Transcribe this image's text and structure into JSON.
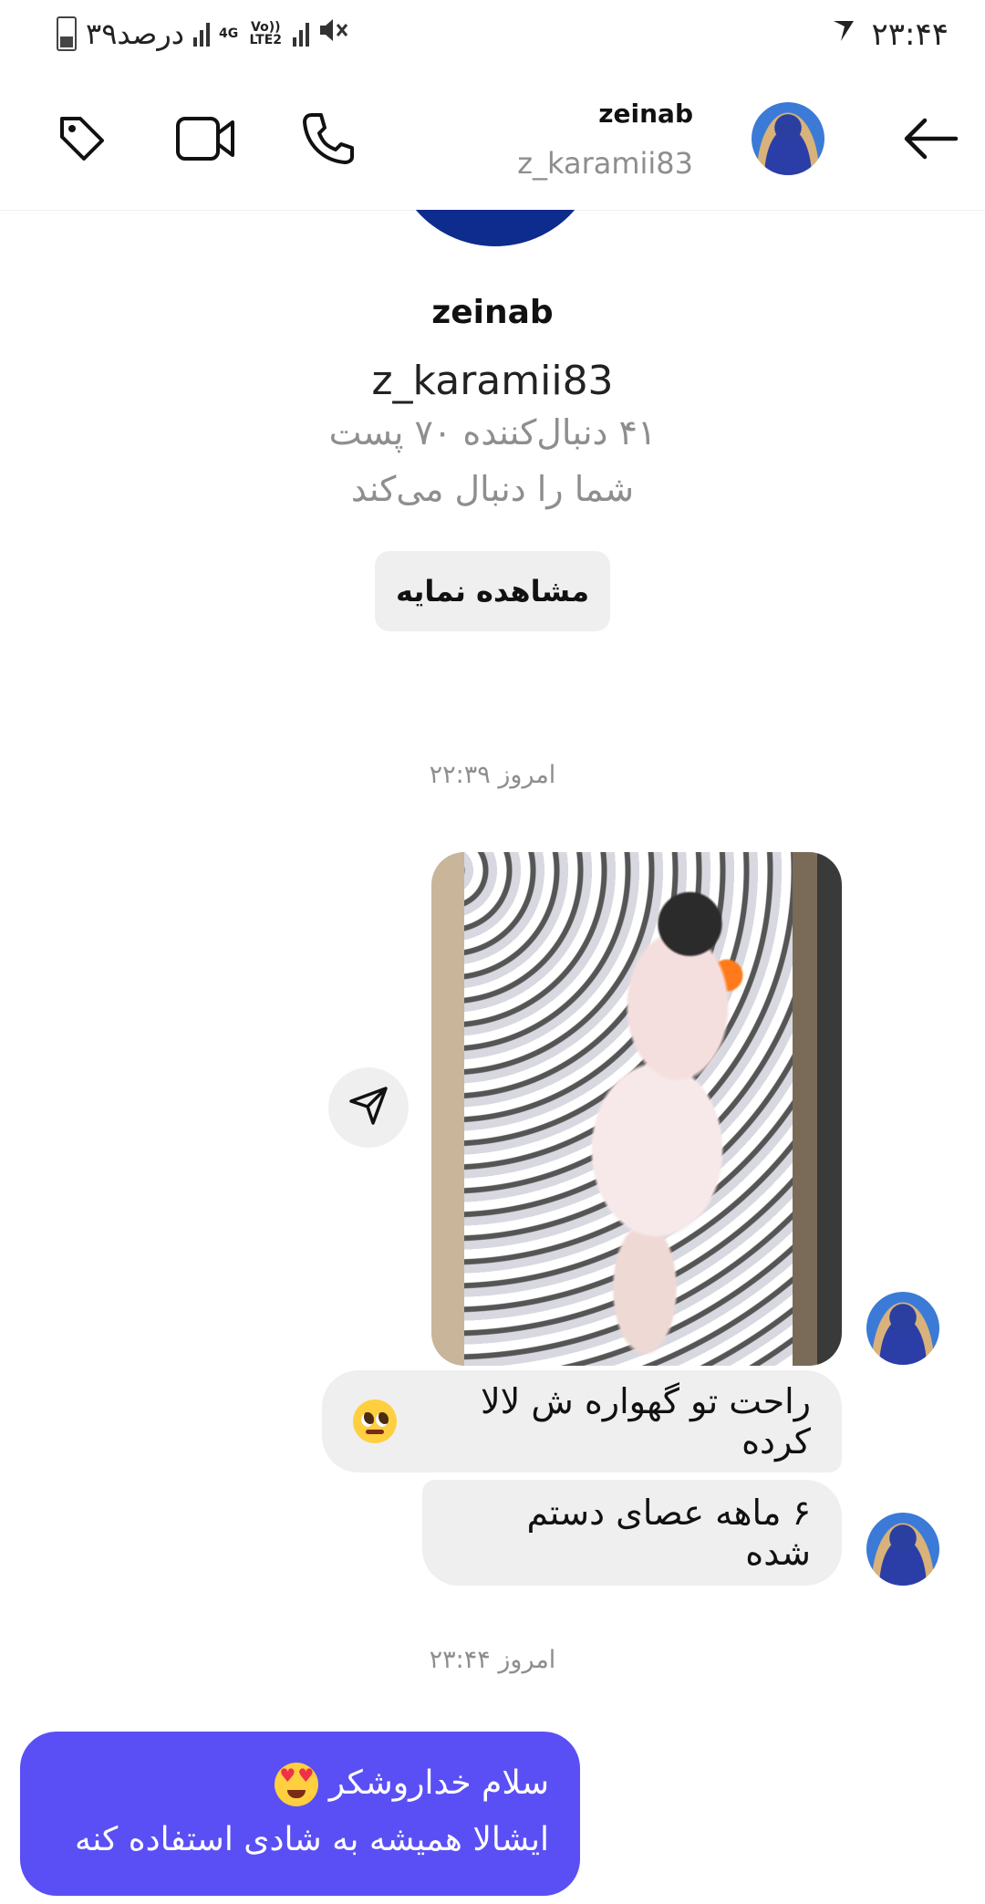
{
  "status_bar": {
    "time": "۲۳:۴۴",
    "battery_text": "۳۹درصد",
    "network_4g": "4G",
    "network_volte": "Vo)) LTE2",
    "carrier_icon": "check-logo-icon"
  },
  "header": {
    "name": "zeinab",
    "username": "z_karamii83",
    "icons": [
      "back-arrow-icon",
      "phone-icon",
      "video-icon",
      "tag-icon"
    ]
  },
  "profile": {
    "name": "zeinab",
    "username": "z_karamii83",
    "stats": "۴۱ دنبال‌کننده ۷۰ پست",
    "follows_you": "شما را دنبال می‌کند",
    "view_profile": "مشاهده نمایه"
  },
  "messages": {
    "timestamp1": "امروز ۲۲:۳۹",
    "incoming_text1": "راحت تو گهواره ش لالا کرده",
    "incoming_text2": "۶ ماهه عصای دستم شده",
    "timestamp2": "امروز ۲۳:۴۴",
    "outgoing_line1": "سلام خداروشکر",
    "outgoing_line2": "ایشالا همیشه به شادی استفاده کنه",
    "outgoing_color": "#5a4ff5"
  }
}
